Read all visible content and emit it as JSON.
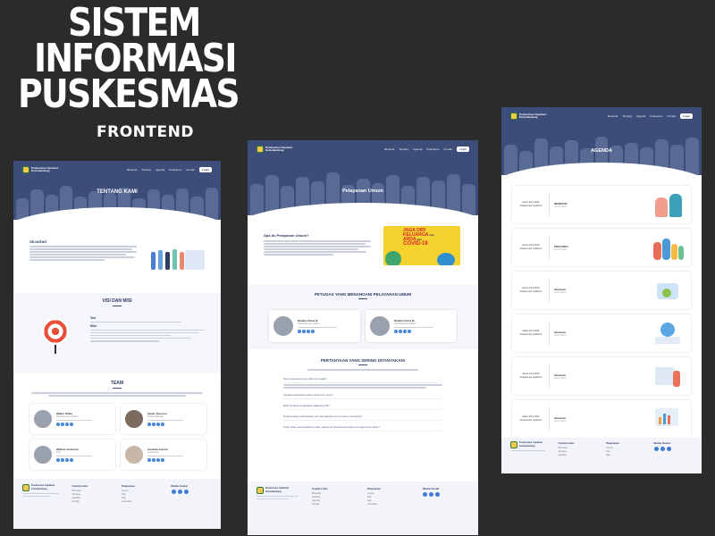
{
  "hero": {
    "line1": "SISTEM",
    "line2": "INFORMASI",
    "line3": "PUSKESMAS",
    "subtitle": "FRONTEND"
  },
  "brand": {
    "name_line1": "Puskesmas Cipaheut",
    "name_line2": "Kota Bandung"
  },
  "nav": {
    "items": [
      "Beranda",
      "Tentang",
      "Agenda",
      "Pelayanan",
      "Kontak"
    ],
    "login": "Login"
  },
  "page_about": {
    "heading": "TENTANG KAMI",
    "history_title": "SEJARAH",
    "vision_title": "VISI DAN MISI",
    "vision_label": "Visi",
    "mission_label": "Misi",
    "team_title": "TEAM",
    "team": [
      {
        "name": "Walter White",
        "role": "Chief Executive Officer"
      },
      {
        "name": "Sarah Jhonson",
        "role": "Product Manager"
      },
      {
        "name": "William Anderson",
        "role": "CTO"
      },
      {
        "name": "Amanda Jepson",
        "role": "Accountant"
      }
    ]
  },
  "page_service": {
    "heading": "Pelayanan Umum",
    "intro_title": "Apa Itu Pelayanan Umum?",
    "banner_line1": "JAGA DIRI",
    "banner_line2": "KELUARGA",
    "banner_line3": "ANDA",
    "banner_line4": "COVID-19",
    "banner_dari1": "dan",
    "banner_dari2": "dari",
    "officers_title": "PETUGAS YANG MENANGANI PELAYANAN UMUM",
    "officers": [
      {
        "name": "Riskiko Putra M",
        "role": "Chief Executive Officer"
      },
      {
        "name": "Riskiko Putra M",
        "role": "Chief Executive Officer"
      }
    ],
    "faq_title": "PERTANYAAN YANG SERING DITANYAKAN!",
    "faq": [
      "Non consectetur amet ulla proin quam?",
      "Feugiat scelerisque varius morbi enim nunc?",
      "Dolor sit amet consectetur adipiscing elit?",
      "Tempus quam pellentesque nec nam aliquam sem et tortor consequat?",
      "Tortor vitae purus faucibus ornare. Varius vel pharetra vel turpis nunc eget lorem dolor?"
    ]
  },
  "page_agenda": {
    "heading": "AGENDA",
    "items": [
      {
        "date": "Senin 20-6-2022",
        "place": "Puskesmas Cipaheut",
        "title": "IMUNISASI",
        "sub": "Lorem Ipsum"
      },
      {
        "date": "Kamis 23-6-2022",
        "place": "Puskesmas Cipaheut",
        "title": "POSYANDU",
        "sub": "Lorem Ipsum"
      },
      {
        "date": "Kamis 23-6-2022",
        "place": "Puskesmas Cipaheut",
        "title": "Imunisasi",
        "sub": "Lorem Ipsum"
      },
      {
        "date": "Rabu 22-6-2022",
        "place": "Puskesmas Cipaheut",
        "title": "Imunisasi",
        "sub": "Lorem Ipsum"
      },
      {
        "date": "Jumat 24-6-2022",
        "place": "Puskesmas Cipaheut",
        "title": "Imunisasi",
        "sub": "Lorem Ipsum"
      },
      {
        "date": "Sabtu 25-6-2022",
        "place": "Puskesmas Cipaheut",
        "title": "Imunisasi",
        "sub": "Lorem Ipsum"
      }
    ]
  },
  "footer": {
    "links_title": "Useful Links",
    "services_title": "Pelayanan",
    "social_title": "Media Sosial",
    "links": [
      "Beranda",
      "Tentang",
      "Agenda",
      "Kontak"
    ],
    "services": [
      "Umum",
      "KIA",
      "Gigi",
      "Imunisasi",
      "Posyandu",
      "KB"
    ]
  },
  "colors": {
    "header": "#3d4d7a",
    "background": "#2b2b2b",
    "accent": "#3d7bd6"
  }
}
